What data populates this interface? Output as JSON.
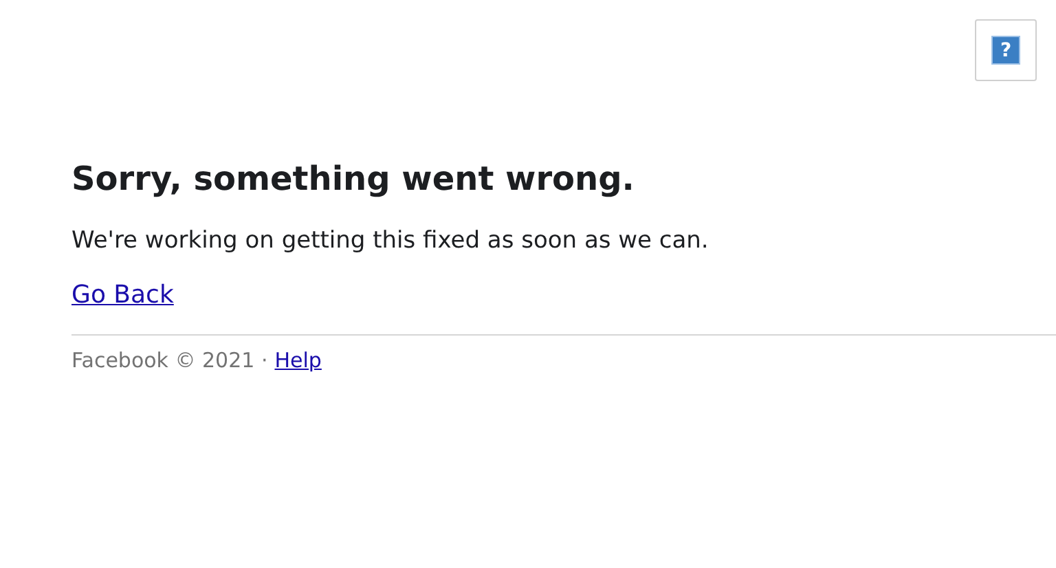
{
  "help_button": {
    "glyph": "?"
  },
  "title": "Sorry, something went wrong.",
  "message": "We're working on getting this fixed as soon as we can.",
  "back_link": "Go Back",
  "footer": {
    "text": "Facebook © 2021 ·",
    "link": "Help"
  }
}
